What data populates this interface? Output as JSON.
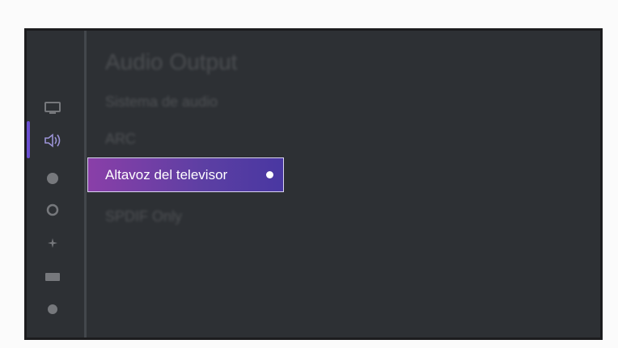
{
  "screen": {
    "title": "Audio Output",
    "items": [
      {
        "label": "Sistema de audio"
      },
      {
        "label": "ARC"
      },
      {
        "label": "Altavoz del televisor",
        "selected": true
      },
      {
        "label": "SPDIF Only"
      }
    ]
  },
  "sidebar": {
    "icons": [
      {
        "name": "picture-icon"
      },
      {
        "name": "sound-icon",
        "active": true
      },
      {
        "name": "network-icon"
      },
      {
        "name": "channel-icon"
      },
      {
        "name": "accessibility-icon"
      },
      {
        "name": "system-icon"
      },
      {
        "name": "support-icon"
      }
    ]
  },
  "colors": {
    "screen_bg": "#2d3034",
    "accent": "#6a4fd1",
    "selection_gradient_start": "#8a3fa8",
    "selection_gradient_end": "#4937a2"
  }
}
